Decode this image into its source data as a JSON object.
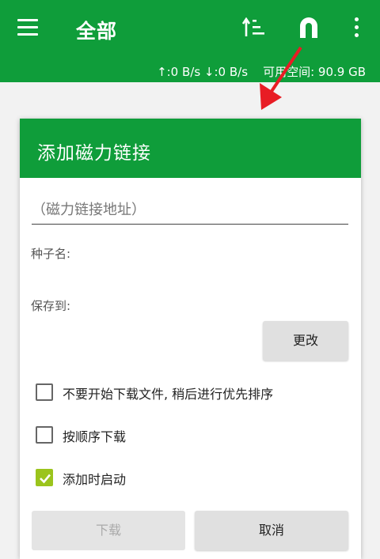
{
  "appbar": {
    "title": "全部",
    "status": "↑:0 B/s ↓:0 B/s    可用空间: 90.9 GB",
    "color": "#0f9d3a"
  },
  "dialog": {
    "title": "添加磁力链接",
    "magnet_placeholder": "（磁力链接地址）",
    "torrent_name_label": "种子名:",
    "save_to_label": "保存到:",
    "change_button": "更改",
    "options": [
      {
        "label": "不要开始下载文件, 稍后进行优先排序",
        "checked": false
      },
      {
        "label": "按顺序下载",
        "checked": false
      },
      {
        "label": "添加时启动",
        "checked": true
      }
    ],
    "download_button": "下载",
    "cancel_button": "取消",
    "accent_color": "#9bc41c"
  },
  "icons": {
    "menu": "hamburger-menu-icon",
    "sort": "sort-icon",
    "magnet": "magnet-icon",
    "more": "more-vert-icon",
    "arrow": "red-arrow-annotation"
  }
}
